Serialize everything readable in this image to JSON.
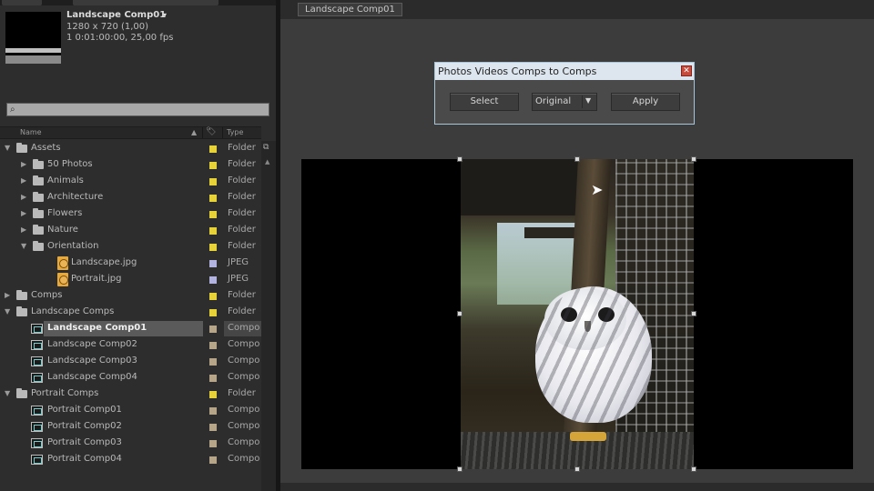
{
  "project": {
    "comp_name": "Landscape Comp01",
    "comp_name_arrow": "▾",
    "resolution": "1280 x 720 (1,00)",
    "duration": "1 0:01:00:00, 25,00 fps",
    "search_glyph": "⌕",
    "columns": {
      "name": "Name",
      "type": "Type",
      "sort_glyph": "▲",
      "label_glyph": "🏷"
    },
    "rows": [
      {
        "indent": 0,
        "kind": "folder",
        "open": true,
        "name": "Assets",
        "color": "#e8d23a",
        "type": "Folder"
      },
      {
        "indent": 1,
        "kind": "folder",
        "open": false,
        "name": "50 Photos",
        "color": "#e8d23a",
        "type": "Folder"
      },
      {
        "indent": 1,
        "kind": "folder",
        "open": false,
        "name": "Animals",
        "color": "#e8d23a",
        "type": "Folder"
      },
      {
        "indent": 1,
        "kind": "folder",
        "open": false,
        "name": "Architecture",
        "color": "#e8d23a",
        "type": "Folder"
      },
      {
        "indent": 1,
        "kind": "folder",
        "open": false,
        "name": "Flowers",
        "color": "#e8d23a",
        "type": "Folder"
      },
      {
        "indent": 1,
        "kind": "folder",
        "open": false,
        "name": "Nature",
        "color": "#e8d23a",
        "type": "Folder"
      },
      {
        "indent": 1,
        "kind": "folder",
        "open": true,
        "name": "Orientation",
        "color": "#e8d23a",
        "type": "Folder"
      },
      {
        "indent": 2,
        "kind": "jpg",
        "open": null,
        "name": "Landscape.jpg",
        "color": "#b3b3e0",
        "type": "JPEG"
      },
      {
        "indent": 2,
        "kind": "jpg",
        "open": null,
        "name": "Portrait.jpg",
        "color": "#b3b3e0",
        "type": "JPEG"
      },
      {
        "indent": 0,
        "kind": "folder",
        "open": false,
        "name": "Comps",
        "color": "#e8d23a",
        "type": "Folder"
      },
      {
        "indent": 0,
        "kind": "folder",
        "open": true,
        "name": "Landscape Comps",
        "color": "#e8d23a",
        "type": "Folder"
      },
      {
        "indent": 1,
        "kind": "comp",
        "open": null,
        "name": "Landscape Comp01",
        "color": "#b7a58a",
        "type": "Compo",
        "selected": true
      },
      {
        "indent": 1,
        "kind": "comp",
        "open": null,
        "name": "Landscape Comp02",
        "color": "#b7a58a",
        "type": "Compo"
      },
      {
        "indent": 1,
        "kind": "comp",
        "open": null,
        "name": "Landscape Comp03",
        "color": "#b7a58a",
        "type": "Compo"
      },
      {
        "indent": 1,
        "kind": "comp",
        "open": null,
        "name": "Landscape Comp04",
        "color": "#b7a58a",
        "type": "Compo"
      },
      {
        "indent": 0,
        "kind": "folder",
        "open": true,
        "name": "Portrait Comps",
        "color": "#e8d23a",
        "type": "Folder"
      },
      {
        "indent": 1,
        "kind": "comp",
        "open": null,
        "name": "Portrait Comp01",
        "color": "#b7a58a",
        "type": "Compo"
      },
      {
        "indent": 1,
        "kind": "comp",
        "open": null,
        "name": "Portrait Comp02",
        "color": "#b7a58a",
        "type": "Compo"
      },
      {
        "indent": 1,
        "kind": "comp",
        "open": null,
        "name": "Portrait Comp03",
        "color": "#b7a58a",
        "type": "Compo"
      },
      {
        "indent": 1,
        "kind": "comp",
        "open": null,
        "name": "Portrait Comp04",
        "color": "#b7a58a",
        "type": "Compo"
      }
    ]
  },
  "viewer": {
    "tab_label": "Landscape Comp01"
  },
  "dialog": {
    "title": "Photos Videos Comps to Comps",
    "close_glyph": "✕",
    "select_label": "Select",
    "dropdown_value": "Original",
    "dropdown_glyph": "▼",
    "apply_label": "Apply"
  }
}
